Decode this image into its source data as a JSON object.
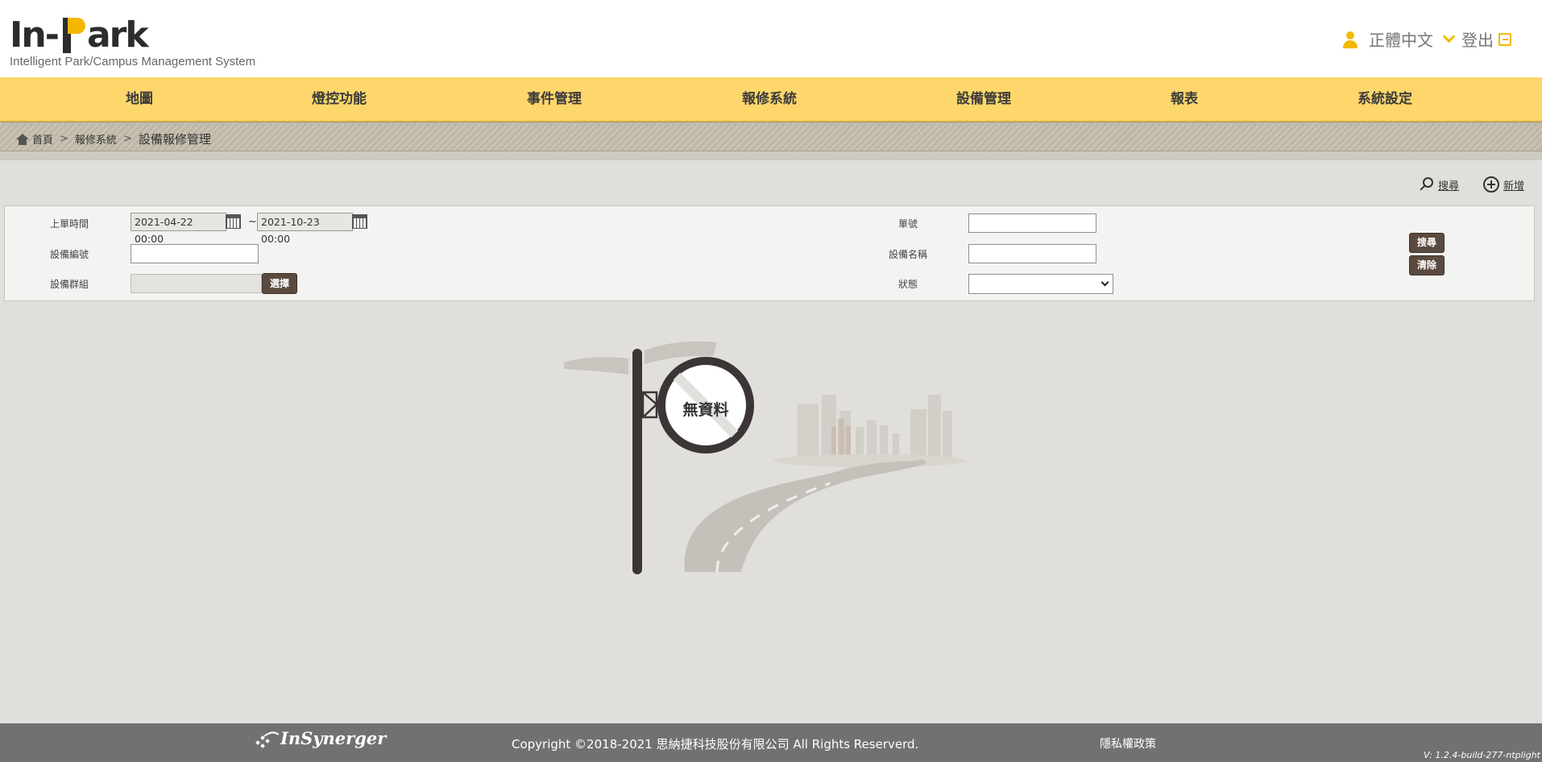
{
  "header": {
    "logo_text": "In-Park",
    "logo_subtitle": "Intelligent Park/Campus Management System",
    "language": "正體中文",
    "logout_label": "登出"
  },
  "nav": {
    "items": [
      {
        "label": "地圖"
      },
      {
        "label": "燈控功能"
      },
      {
        "label": "事件管理"
      },
      {
        "label": "報修系統"
      },
      {
        "label": "設備管理"
      },
      {
        "label": "報表"
      },
      {
        "label": "系統設定"
      }
    ]
  },
  "breadcrumb": {
    "home": "首頁",
    "sep": ">",
    "section": "報修系統",
    "current": "設備報修管理"
  },
  "actions": {
    "search_label": "搜尋",
    "add_label": "新增"
  },
  "filter": {
    "time_label": "上單時間",
    "start_date": "2021-04-22 00:00",
    "tilde": "~",
    "end_date": "2021-10-23 00:00",
    "order_no_label": "單號",
    "order_no_value": "",
    "device_no_label": "設備編號",
    "device_no_value": "",
    "device_name_label": "設備名稱",
    "device_name_value": "",
    "device_group_label": "設備群組",
    "device_group_value": "",
    "select_button": "選擇",
    "status_label": "狀態",
    "status_value": "",
    "search_button": "搜尋",
    "clear_button": "清除"
  },
  "empty_state": {
    "label": "無資料"
  },
  "footer": {
    "brand": "InSynerger",
    "copyright": "Copyright ©2018-2021 思納捷科技股份有限公司 All Rights Reserverd.",
    "privacy": "隱私權政策",
    "version": "V: 1.2.4-build-277-ntplight"
  },
  "colors": {
    "nav_bg": "#fdd76b",
    "accent": "#f5b800",
    "button_dark": "#5a4a3f",
    "footer_bg": "#717171",
    "page_bg": "#e1dfdb"
  }
}
